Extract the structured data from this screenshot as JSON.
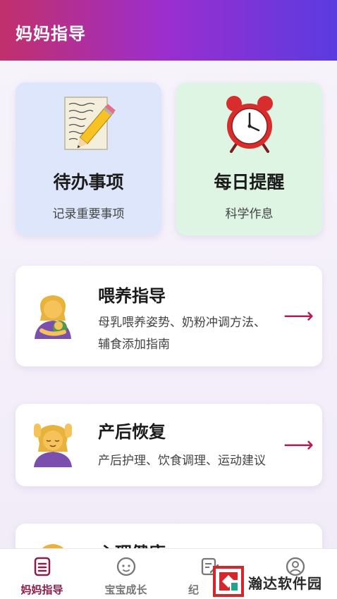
{
  "header": {
    "title": "妈妈指导"
  },
  "tiles": [
    {
      "title": "待办事项",
      "subtitle": "记录重要事项",
      "icon": "memo-icon"
    },
    {
      "title": "每日提醒",
      "subtitle": "科学作息",
      "icon": "alarm-clock-icon"
    }
  ],
  "cards": [
    {
      "title": "喂养指导",
      "desc_line1": "母乳喂养姿势、奶粉冲调方法、",
      "desc_line2": "辅食添加指南",
      "arrow": "⟶",
      "icon": "breastfeeding-icon"
    },
    {
      "title": "产后恢复",
      "desc": "产后护理、饮食调理、运动建议",
      "arrow": "⟶",
      "icon": "massage-icon"
    },
    {
      "title": "心理健康",
      "icon": "woman-icon"
    }
  ],
  "tabbar": {
    "tabs": [
      {
        "label": "妈妈指导",
        "icon": "notebook-icon",
        "active": true
      },
      {
        "label": "宝宝成长",
        "icon": "baby-face-icon",
        "active": false
      },
      {
        "label": "纪",
        "icon": "edit-note-icon",
        "active": false
      },
      {
        "label": "",
        "icon": "profile-icon",
        "active": false
      }
    ]
  },
  "watermark": {
    "text": "瀚达软件园"
  },
  "colors": {
    "header_start": "#c2306b",
    "header_end": "#5a3be0",
    "accent": "#8a1c4e",
    "arrow": "#b31f55"
  }
}
